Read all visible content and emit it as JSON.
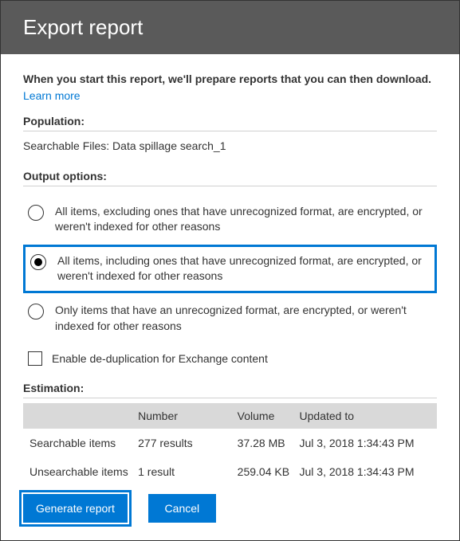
{
  "header": {
    "title": "Export report"
  },
  "intro": {
    "text": "When you start this report, we'll prepare reports that you can then download.",
    "learn_more": "Learn more"
  },
  "population": {
    "label": "Population:",
    "value": "Searchable Files:  Data spillage search_1"
  },
  "output": {
    "label": "Output options:",
    "options": [
      "All items, excluding ones that have unrecognized format, are encrypted, or weren't indexed for other reasons",
      "All items, including ones that have unrecognized format, are encrypted, or weren't indexed for other reasons",
      "Only items that have an unrecognized format, are encrypted, or weren't indexed for other reasons"
    ],
    "dedup": "Enable de-duplication for Exchange content"
  },
  "estimation": {
    "label": "Estimation:",
    "headers": {
      "c1": "",
      "c2": "Number",
      "c3": "Volume",
      "c4": "Updated to"
    },
    "rows": [
      {
        "name": "Searchable items",
        "number": "277 results",
        "volume": "37.28 MB",
        "updated": "Jul 3, 2018 1:34:43 PM"
      },
      {
        "name": "Unsearchable items",
        "number": "1 result",
        "volume": "259.04 KB",
        "updated": "Jul 3, 2018 1:34:43 PM"
      }
    ]
  },
  "buttons": {
    "generate": "Generate report",
    "cancel": "Cancel"
  }
}
